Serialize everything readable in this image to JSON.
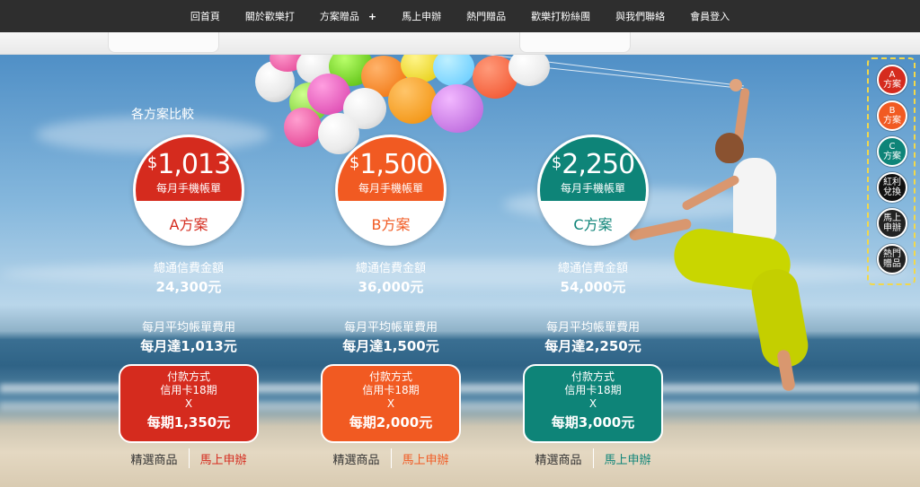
{
  "nav": {
    "items": [
      "回首頁",
      "關於歡樂打",
      "方案贈品",
      "馬上申辦",
      "熱門贈品",
      "歡樂打粉絲團",
      "與我們聯絡",
      "會員登入"
    ],
    "plus": "+"
  },
  "section_title": "各方案比較",
  "plans": [
    {
      "amount": "1,013",
      "currency": "$",
      "amount_sub": "每月手機帳單",
      "name": "A方案",
      "total_label": "總通信費金額",
      "total_value": "24,300元",
      "avg_label": "每月平均帳單費用",
      "avg_value": "每月達1,013元",
      "pay_title": "付款方式",
      "pay_card": "信用卡18期",
      "pay_x": "X",
      "pay_amount": "每期1,350元",
      "link_products": "精選商品",
      "link_apply": "馬上申辦",
      "color": "#d52b1e"
    },
    {
      "amount": "1,500",
      "currency": "$",
      "amount_sub": "每月手機帳單",
      "name": "B方案",
      "total_label": "總通信費金額",
      "total_value": "36,000元",
      "avg_label": "每月平均帳單費用",
      "avg_value": "每月達1,500元",
      "pay_title": "付款方式",
      "pay_card": "信用卡18期",
      "pay_x": "X",
      "pay_amount": "每期2,000元",
      "link_products": "精選商品",
      "link_apply": "馬上申辦",
      "color": "#f15a22"
    },
    {
      "amount": "2,250",
      "currency": "$",
      "amount_sub": "每月手機帳單",
      "name": "C方案",
      "total_label": "總通信費金額",
      "total_value": "54,000元",
      "avg_label": "每月平均帳單費用",
      "avg_value": "每月達2,250元",
      "pay_title": "付款方式",
      "pay_card": "信用卡18期",
      "pay_x": "X",
      "pay_amount": "每期3,000元",
      "link_products": "精選商品",
      "link_apply": "馬上申辦",
      "color": "#0e8478"
    }
  ],
  "side_nav": [
    {
      "line1": "A",
      "line2": "方案",
      "color": "#d52b1e"
    },
    {
      "line1": "B",
      "line2": "方案",
      "color": "#f15a22"
    },
    {
      "line1": "C",
      "line2": "方案",
      "color": "#0e8478"
    },
    {
      "line1": "紅利",
      "line2": "兌換",
      "color": "#111111"
    },
    {
      "line1": "馬上",
      "line2": "申辦",
      "color": "#222222"
    },
    {
      "line1": "熱門",
      "line2": "贈品",
      "color": "#222222"
    }
  ]
}
